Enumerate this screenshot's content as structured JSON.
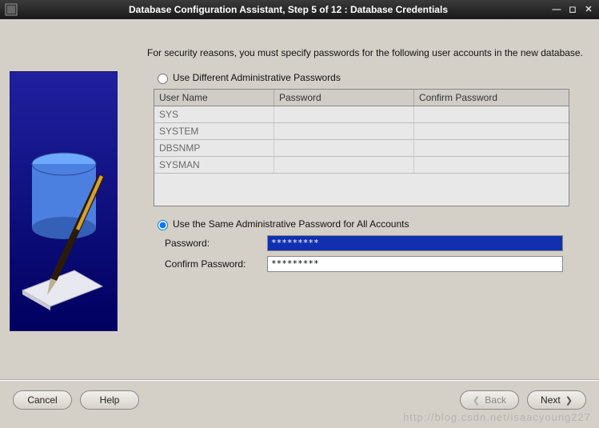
{
  "titlebar": {
    "title": "Database Configuration Assistant, Step 5 of 12 : Database Credentials"
  },
  "intro": "For security reasons, you must specify passwords for the following user accounts in the new database.",
  "option1": {
    "label": "Use Different Administrative Passwords",
    "selected": false
  },
  "table": {
    "headers": {
      "user": "User Name",
      "pass": "Password",
      "confirm": "Confirm Password"
    },
    "rows": [
      {
        "user": "SYS",
        "pass": "",
        "confirm": ""
      },
      {
        "user": "SYSTEM",
        "pass": "",
        "confirm": ""
      },
      {
        "user": "DBSNMP",
        "pass": "",
        "confirm": ""
      },
      {
        "user": "SYSMAN",
        "pass": "",
        "confirm": ""
      }
    ]
  },
  "option2": {
    "label": "Use the Same Administrative Password for All Accounts",
    "selected": true
  },
  "fields": {
    "password_label": "Password:",
    "password_value": "*********",
    "confirm_label": "Confirm Password:",
    "confirm_value": "*********"
  },
  "buttons": {
    "cancel": "Cancel",
    "help": "Help",
    "back": "Back",
    "next": "Next"
  },
  "watermark": "http://blog.csdn.net/isaacyoung227"
}
